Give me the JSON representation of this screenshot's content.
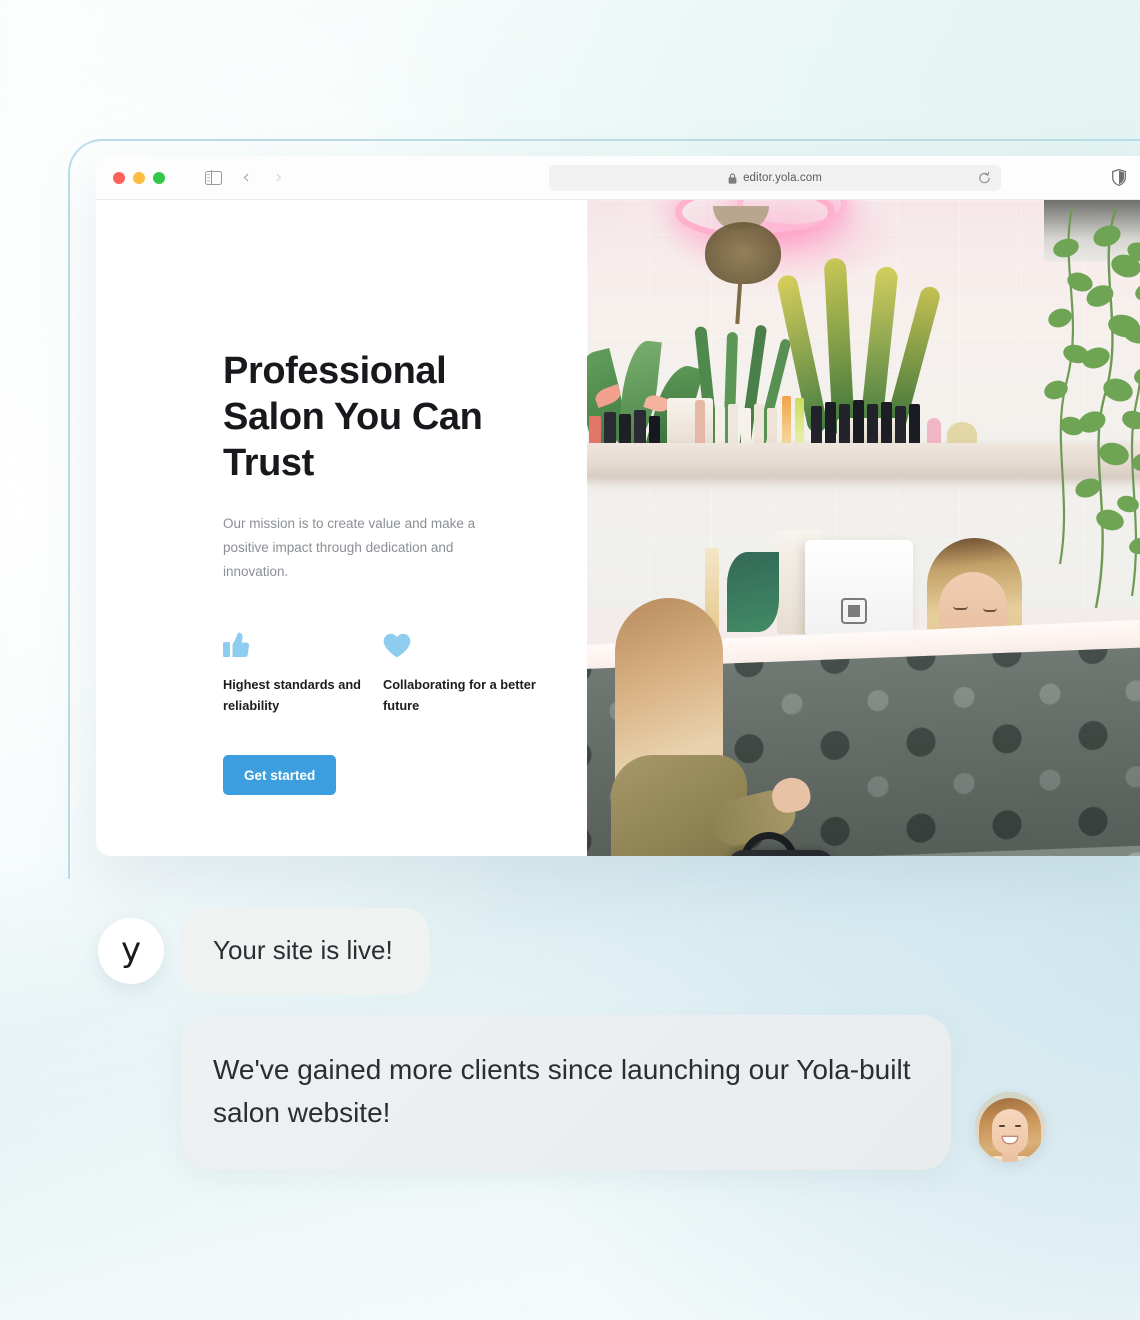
{
  "browser": {
    "window_controls": [
      "close",
      "minimize",
      "maximize"
    ],
    "url": "editor.yola.com",
    "sidebar_toggle_name": "sidebar-toggle",
    "back_label": "‹",
    "forward_label": "›"
  },
  "hero": {
    "title": "Professional Salon You Can Trust",
    "subtitle": "Our mission is to create value and make a positive impact through dedication and innovation.",
    "features": [
      {
        "icon": "thumbs-up-icon",
        "label": "Highest standards and reliability"
      },
      {
        "icon": "heart-icon",
        "label": "Collaborating for a better future"
      }
    ],
    "cta_label": "Get started",
    "photo_alt": "Salon reception counter with stylist and client"
  },
  "chat": {
    "logo_letter": "y",
    "messages": [
      {
        "from": "yola",
        "text": "Your site is live!"
      },
      {
        "from": "customer",
        "text": "We've gained more clients since launching our Yola-built salon website!"
      }
    ],
    "avatar_alt": "Smiling woman profile photo"
  },
  "colors": {
    "accent": "#3c9ede",
    "icon_blue": "#8ecdf0",
    "heading": "#17191c",
    "body_text": "#8b8f94",
    "bubble": "#f0f2f2",
    "frame_border": "#bcdcea",
    "traffic_red": "#fc6058",
    "traffic_yellow": "#fdbd41",
    "traffic_green": "#34c749"
  }
}
